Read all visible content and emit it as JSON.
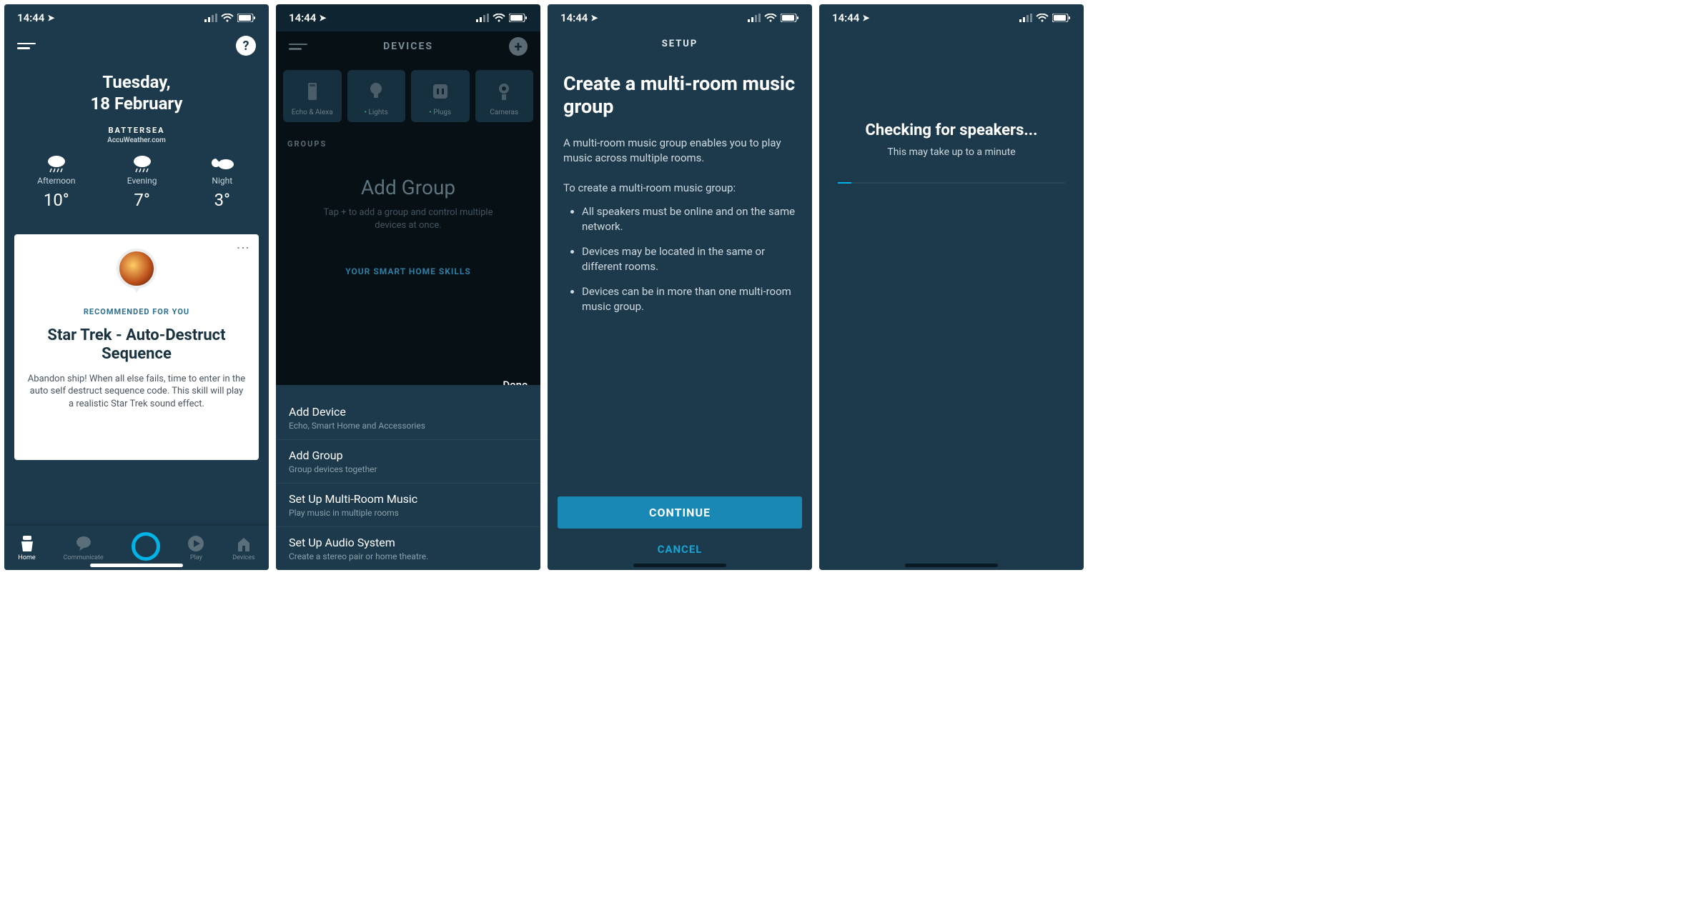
{
  "statusBar": {
    "time": "14:44"
  },
  "screen1": {
    "dateLine1": "Tuesday,",
    "dateLine2": "18 February",
    "location": "BATTERSEA",
    "locationSource": "AccuWeather.com",
    "forecast": [
      {
        "period": "Afternoon",
        "temp": "10°",
        "icon": "rain"
      },
      {
        "period": "Evening",
        "temp": "7°",
        "icon": "rain"
      },
      {
        "period": "Night",
        "temp": "3°",
        "icon": "night-cloud"
      }
    ],
    "card": {
      "badge": "RECOMMENDED FOR YOU",
      "title": "Star Trek - Auto-Destruct Sequence",
      "description": "Abandon ship! When all else fails, time to enter in the auto self destruct sequence code. This skill will play a realistic Star Trek sound effect."
    },
    "tabs": [
      {
        "label": "Home"
      },
      {
        "label": "Communicate"
      },
      {
        "label": ""
      },
      {
        "label": "Play"
      },
      {
        "label": "Devices"
      }
    ]
  },
  "screen2": {
    "headerTitle": "DEVICES",
    "categories": [
      {
        "label": "Echo & Alexa",
        "dot": false
      },
      {
        "label": "Lights",
        "dot": true
      },
      {
        "label": "Plugs",
        "dot": true
      },
      {
        "label": "Cameras",
        "dot": false
      }
    ],
    "groupsHeader": "GROUPS",
    "addGroupTitle": "Add Group",
    "addGroupSub": "Tap + to add a group and control multiple devices at once.",
    "skillsLink": "YOUR SMART HOME SKILLS",
    "doneLabel": "Done",
    "sheet": [
      {
        "title": "Add Device",
        "sub": "Echo, Smart Home and Accessories"
      },
      {
        "title": "Add Group",
        "sub": "Group devices together"
      },
      {
        "title": "Set Up Multi-Room Music",
        "sub": "Play music in multiple rooms"
      },
      {
        "title": "Set Up Audio System",
        "sub": "Create a stereo pair or home theatre."
      }
    ]
  },
  "screen3": {
    "header": "SETUP",
    "title": "Create a multi-room music group",
    "paragraph": "A multi-room music group enables you to play music across multiple rooms.",
    "intro": "To create a multi-room music group:",
    "bullets": [
      "All speakers must be online and on the same network.",
      "Devices may be located in the same or different rooms.",
      "Devices can be in more than one multi-room music group."
    ],
    "continueLabel": "CONTINUE",
    "cancelLabel": "CANCEL"
  },
  "screen4": {
    "title": "Checking for speakers...",
    "sub": "This may take up to a minute"
  }
}
